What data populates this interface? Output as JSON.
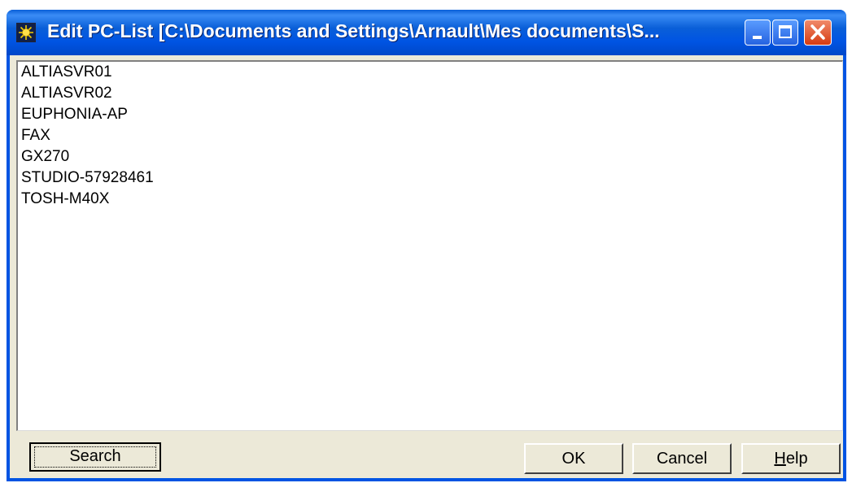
{
  "window": {
    "title": "Edit PC-List [C:\\Documents and Settings\\Arnault\\Mes documents\\S...",
    "icon": "sun-app-icon"
  },
  "pc_list": {
    "items": [
      "ALTIASVR01",
      "ALTIASVR02",
      "EUPHONIA-AP",
      "FAX",
      "GX270",
      "STUDIO-57928461",
      "TOSH-M40X"
    ]
  },
  "buttons": {
    "search": "Search",
    "ok": "OK",
    "cancel": "Cancel",
    "help_prefix": "H",
    "help_rest": "elp"
  },
  "colors": {
    "titlebar": "#0054e3",
    "close_button": "#d63b12",
    "dialog_bg": "#ece9d8",
    "icon_sun": "#f5d000"
  }
}
